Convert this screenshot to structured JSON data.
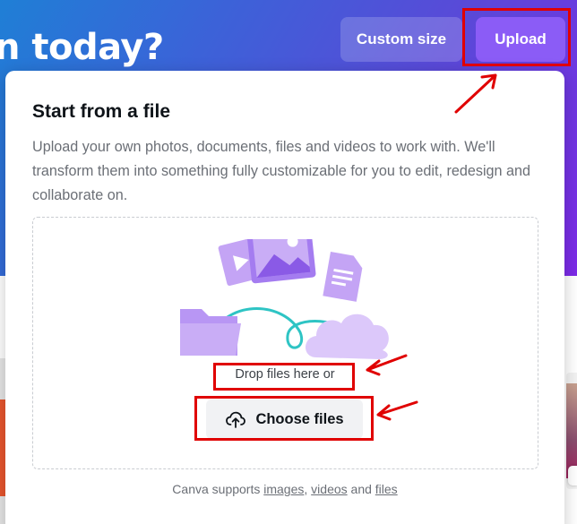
{
  "hero": {
    "title": "n today?",
    "custom_size_label": "Custom size",
    "upload_label": "Upload"
  },
  "upload_panel": {
    "title": "Start from a file",
    "description": "Upload your own photos, documents, files and videos to work with. We'll transform them into something fully customizable for you to edit, redesign and collaborate on.",
    "drop_text": "Drop files here or",
    "choose_files_label": "Choose files",
    "supports": {
      "prefix": "Canva supports",
      "images": "images",
      "sep1": ",",
      "videos": "videos",
      "and": "and",
      "files": "files"
    }
  },
  "icons": {
    "upload_cloud": "cloud-upload-icon",
    "illustration": "upload-illustration"
  },
  "colors": {
    "accent_purple": "#8b5cf6",
    "annotation_red": "#e00000",
    "hero_gradient_start": "#1f7fd6",
    "hero_gradient_end": "#7d2ae8"
  }
}
